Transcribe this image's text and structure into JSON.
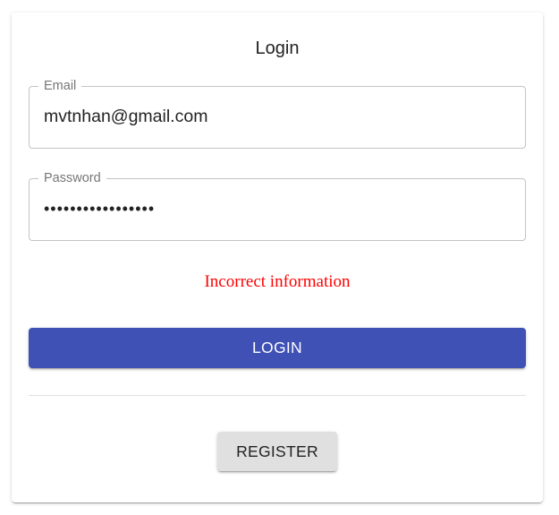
{
  "login_form": {
    "title": "Login",
    "email": {
      "label": "Email",
      "value": "mvtnhan@gmail.com"
    },
    "password": {
      "label": "Password",
      "value": "•••••••••••••••••"
    },
    "error_message": "Incorrect information",
    "login_button_label": "LOGIN",
    "register_button_label": "REGISTER"
  },
  "colors": {
    "primary": "#3f51b5",
    "error": "#ff0000",
    "secondary_button": "#e0e0e0"
  }
}
